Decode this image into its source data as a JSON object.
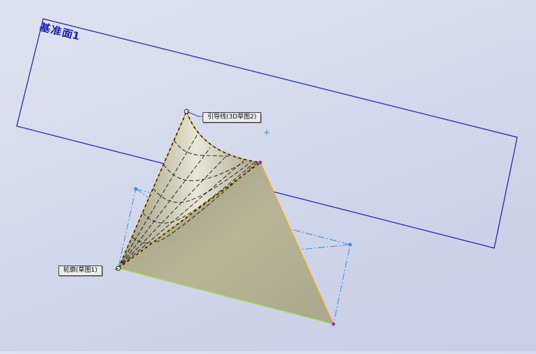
{
  "plane": {
    "label": "基准面1"
  },
  "callouts": {
    "guide_curve": "引导线(3D草图2)",
    "profile": "轮廓(草图1)"
  },
  "colors": {
    "plane_edge": "#1c1cc8",
    "surface": "#bdbc9a",
    "sketch_dashdot": "#3a8fe0",
    "selection_dash": "#e6a81a",
    "endpoint": "#9a2bd6",
    "profile_edge": "#9be04a"
  }
}
